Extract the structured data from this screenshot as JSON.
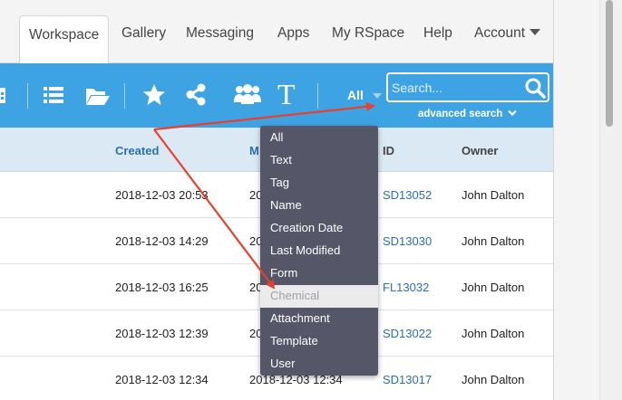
{
  "nav": {
    "tabs": [
      {
        "label": "Workspace",
        "active": true
      },
      {
        "label": "Gallery"
      },
      {
        "label": "Messaging"
      },
      {
        "label": "Apps"
      },
      {
        "label": "My RSpace"
      },
      {
        "label": "Help"
      },
      {
        "label": "Account"
      }
    ]
  },
  "toolbar": {
    "icons": [
      "calendar-icon",
      "list-icon",
      "folder-open-icon",
      "star-icon",
      "share-icon",
      "group-icon",
      "text-icon"
    ],
    "text_icon_glyph": "T",
    "filter_label": "All",
    "search_placeholder": "Search...",
    "advanced_search_label": "advanced search"
  },
  "table": {
    "headers": {
      "created": "Created",
      "modified": "M",
      "id": "ID",
      "owner": "Owner"
    },
    "rows": [
      {
        "created": "2018-12-03 20:53",
        "modified": "20",
        "id": "SD13052",
        "owner": "John Dalton"
      },
      {
        "created": "2018-12-03 14:29",
        "modified": "20",
        "id": "SD13030",
        "owner": "John Dalton"
      },
      {
        "created": "2018-12-03 16:25",
        "modified": "20",
        "id": "FL13032",
        "owner": "John Dalton"
      },
      {
        "created": "2018-12-03 12:39",
        "modified": "20",
        "id": "SD13022",
        "owner": "John Dalton"
      },
      {
        "created": "2018-12-03 12:34",
        "modified": "2018-12-03 12:34",
        "id": "SD13017",
        "owner": "John Dalton"
      }
    ]
  },
  "dropdown": {
    "items": [
      {
        "label": "All"
      },
      {
        "label": "Text"
      },
      {
        "label": "Tag"
      },
      {
        "label": "Name"
      },
      {
        "label": "Creation Date"
      },
      {
        "label": "Last Modified"
      },
      {
        "label": "Form"
      },
      {
        "label": "Chemical",
        "hovered": true
      },
      {
        "label": "Attachment"
      },
      {
        "label": "Template"
      },
      {
        "label": "User"
      }
    ]
  },
  "colors": {
    "toolbar": "#3ea3e2",
    "dropdown_bg": "#555668",
    "link": "#2b6fb3",
    "annotation_arrow": "#e8402d"
  }
}
